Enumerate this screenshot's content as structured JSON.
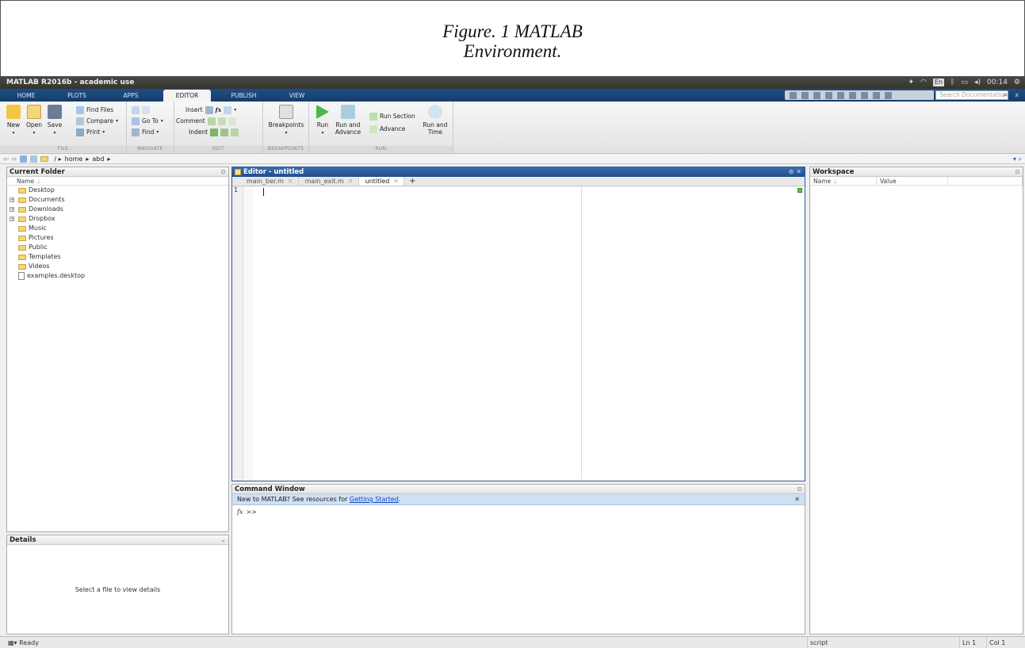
{
  "caption": {
    "line1": "Figure. 1 MATLAB",
    "line2": "Environment."
  },
  "window": {
    "title": "MATLAB R2016b - academic use"
  },
  "system_tray": {
    "lang": "En",
    "clock": "00:14"
  },
  "ribbon_tabs": [
    "HOME",
    "PLOTS",
    "APPS",
    "EDITOR",
    "PUBLISH",
    "VIEW"
  ],
  "active_tab": "EDITOR",
  "search": {
    "placeholder": "Search Documentation"
  },
  "toolstrip": {
    "file": {
      "label": "FILE",
      "new": "New",
      "open": "Open",
      "save": "Save",
      "find_files": "Find Files",
      "compare": "Compare",
      "print": "Print"
    },
    "navigate": {
      "label": "NAVIGATE",
      "go_to": "Go To",
      "find": "Find"
    },
    "edit": {
      "label": "EDIT",
      "insert": "Insert",
      "comment": "Comment",
      "indent": "Indent",
      "fx": "fx"
    },
    "breakpoints": {
      "label": "BREAKPOINTS",
      "breakpoints": "Breakpoints"
    },
    "run": {
      "label": "RUN",
      "run": "Run",
      "run_advance_1": "Run and",
      "run_advance_2": "Advance",
      "run_section": "Run Section",
      "advance": "Advance",
      "run_time_1": "Run and",
      "run_time_2": "Time"
    }
  },
  "address": {
    "path": [
      "home",
      "abd"
    ]
  },
  "current_folder": {
    "title": "Current Folder",
    "name_col": "Name",
    "items": [
      {
        "name": "Desktop",
        "type": "folder",
        "expandable": false
      },
      {
        "name": "Documents",
        "type": "folder",
        "expandable": true
      },
      {
        "name": "Downloads",
        "type": "folder",
        "expandable": true
      },
      {
        "name": "Dropbox",
        "type": "folder",
        "expandable": true
      },
      {
        "name": "Music",
        "type": "folder",
        "expandable": false
      },
      {
        "name": "Pictures",
        "type": "folder",
        "expandable": false
      },
      {
        "name": "Public",
        "type": "folder",
        "expandable": false
      },
      {
        "name": "Templates",
        "type": "folder",
        "expandable": false
      },
      {
        "name": "Videos",
        "type": "folder",
        "expandable": false
      },
      {
        "name": "examples.desktop",
        "type": "file",
        "expandable": false
      }
    ]
  },
  "details": {
    "title": "Details",
    "message": "Select a file to view details"
  },
  "editor": {
    "title": "Editor - untitled",
    "tabs": [
      "main_ber.m",
      "main_exit.m",
      "untitled"
    ],
    "active_tab": "untitled",
    "line_number": "1"
  },
  "command_window": {
    "title": "Command Window",
    "banner_text": "New to MATLAB? See resources for ",
    "banner_link": "Getting Started",
    "banner_end": ".",
    "prompt": ">>"
  },
  "workspace": {
    "title": "Workspace",
    "col_name": "Name",
    "col_value": "Value"
  },
  "status": {
    "left": "Ready",
    "type": "script",
    "ln": "Ln 1",
    "col": "Col 1"
  }
}
